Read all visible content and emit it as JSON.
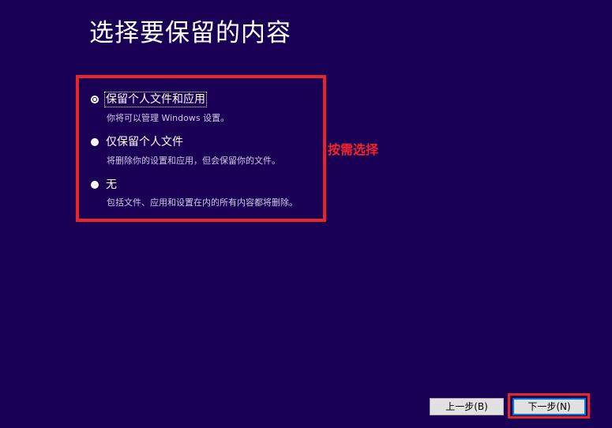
{
  "page": {
    "title": "选择要保留的内容"
  },
  "options": [
    {
      "label": "保留个人文件和应用",
      "description": "你将可以管理 Windows 设置。",
      "selected": true
    },
    {
      "label": "仅保留个人文件",
      "description": "将删除你的设置和应用，但会保留你的文件。",
      "selected": false
    },
    {
      "label": "无",
      "description": "包括文件、应用和设置在内的所有内容都将删除。",
      "selected": false
    }
  ],
  "annotation": {
    "text": "按需选择",
    "color": "#e8262a"
  },
  "buttons": {
    "back_label": "上一步(B)",
    "next_label": "下一步(N)"
  },
  "colors": {
    "background": "#1a0054",
    "highlight": "#e8262a",
    "focus_border": "#0078d7"
  }
}
